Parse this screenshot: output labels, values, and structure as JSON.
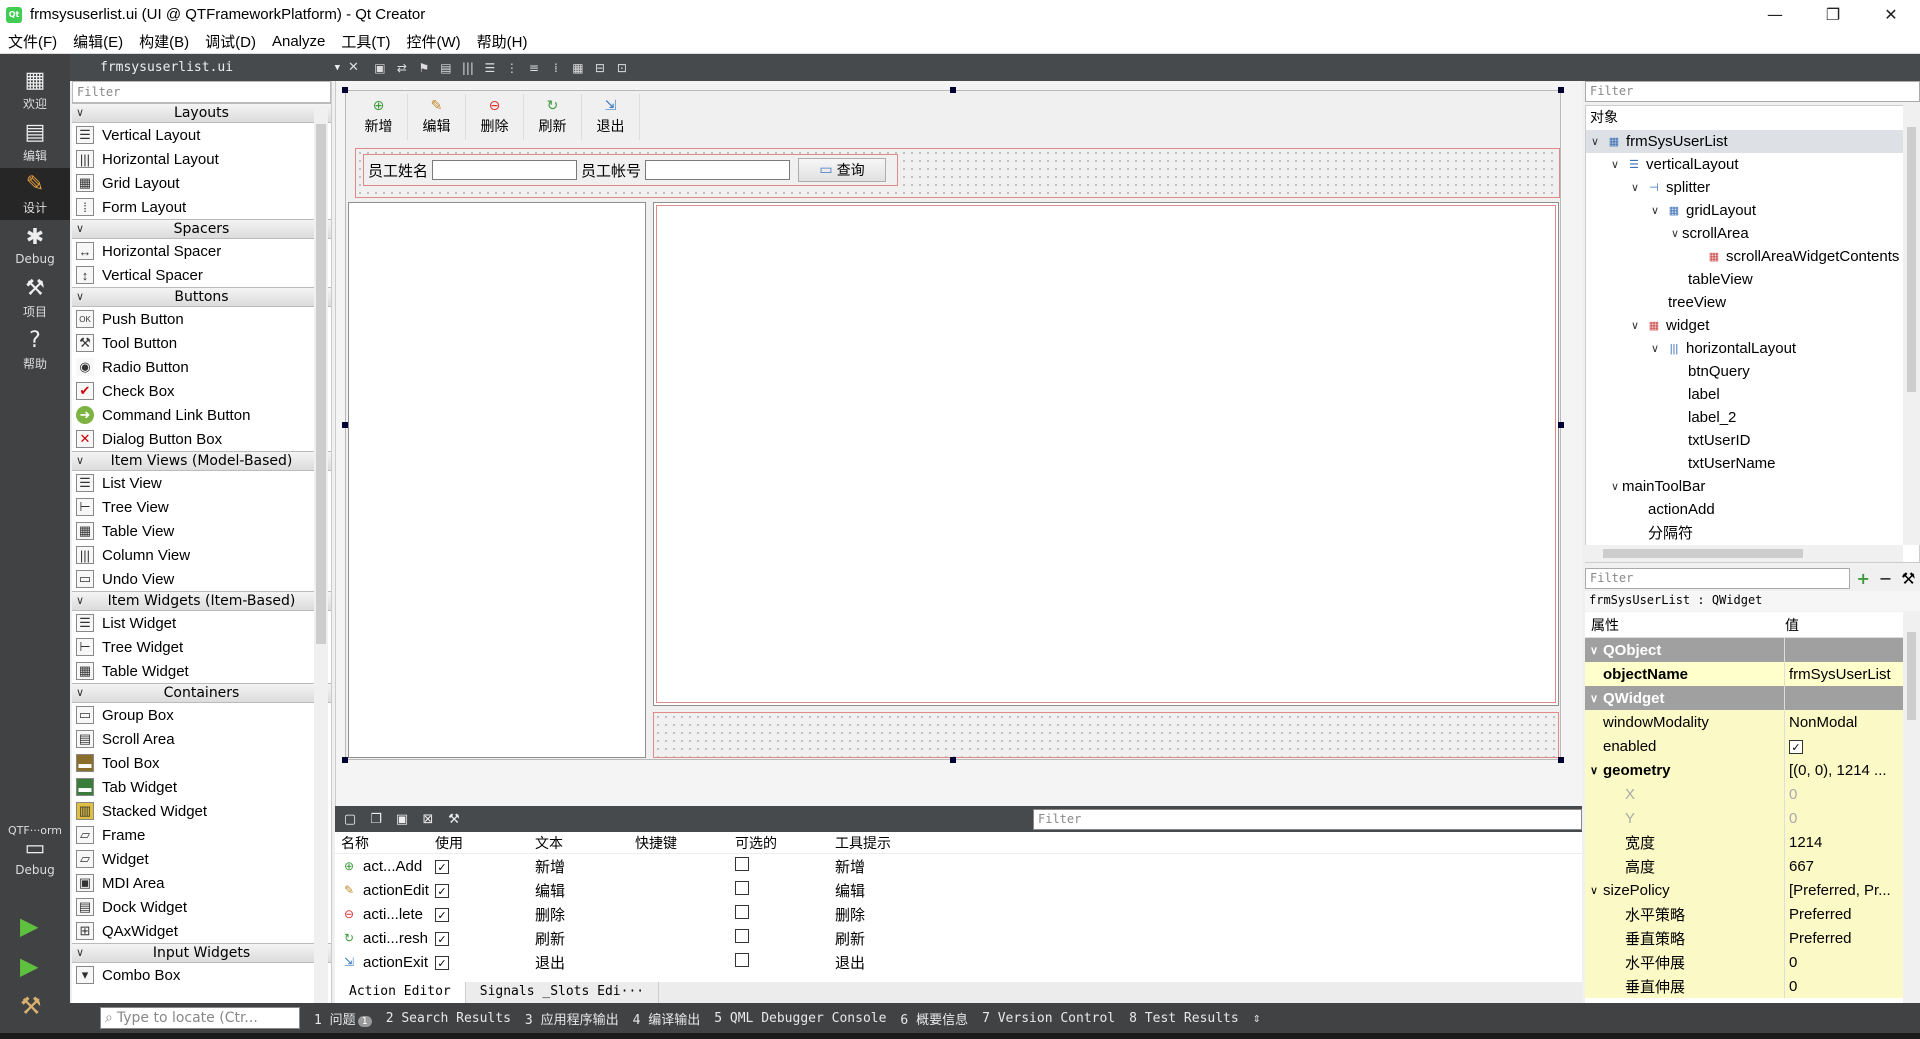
{
  "window": {
    "title": "frmsysuserlist.ui (UI @ QTFrameworkPlatform) - Qt Creator",
    "minimize": "—",
    "restore": "❐",
    "close": "✕"
  },
  "menu": [
    "文件(F)",
    "编辑(E)",
    "构建(B)",
    "调试(D)",
    "Analyze",
    "工具(T)",
    "控件(W)",
    "帮助(H)"
  ],
  "modes": {
    "welcome": "欢迎",
    "edit": "编辑",
    "design": "设计",
    "debug": "Debug",
    "projects": "项目",
    "help": "帮助",
    "kit_label": "QTF···orm",
    "kit_mode": "Debug"
  },
  "editor": {
    "file": "frmsysuserlist.ui",
    "close": "✕"
  },
  "widgetbox": {
    "filter_placeholder": "Filter",
    "categories": {
      "layouts": "Layouts",
      "spacers": "Spacers",
      "buttons": "Buttons",
      "item_views": "Item Views (Model-Based)",
      "item_widgets": "Item Widgets (Item-Based)",
      "containers": "Containers",
      "input_widgets": "Input Widgets"
    },
    "layouts": [
      "Vertical Layout",
      "Horizontal Layout",
      "Grid Layout",
      "Form Layout"
    ],
    "spacers": [
      "Horizontal Spacer",
      "Vertical Spacer"
    ],
    "buttons": [
      "Push Button",
      "Tool Button",
      "Radio Button",
      "Check Box",
      "Command Link Button",
      "Dialog Button Box"
    ],
    "item_views": [
      "List View",
      "Tree View",
      "Table View",
      "Column View",
      "Undo View"
    ],
    "item_widgets": [
      "List Widget",
      "Tree Widget",
      "Table Widget"
    ],
    "containers": [
      "Group Box",
      "Scroll Area",
      "Tool Box",
      "Tab Widget",
      "Stacked Widget",
      "Frame",
      "Widget",
      "MDI Area",
      "Dock Widget",
      "QAxWidget"
    ],
    "input_widgets": [
      "Combo Box"
    ]
  },
  "form": {
    "toolbar": [
      "新增",
      "编辑",
      "删除",
      "刷新",
      "退出"
    ],
    "label_name": "员工姓名",
    "label_account": "员工帐号",
    "query_button": "查询"
  },
  "action_editor": {
    "filter_placeholder": "Filter",
    "headers": [
      "名称",
      "使用",
      "文本",
      "快捷键",
      "可选的",
      "工具提示"
    ],
    "rows": [
      {
        "name": "act...Add",
        "used": "✓",
        "text": "新增",
        "tooltip": "新增"
      },
      {
        "name": "actionEdit",
        "used": "✓",
        "text": "编辑",
        "tooltip": "编辑"
      },
      {
        "name": "acti...lete",
        "used": "✓",
        "text": "删除",
        "tooltip": "删除"
      },
      {
        "name": "acti...resh",
        "used": "✓",
        "text": "刷新",
        "tooltip": "刷新"
      },
      {
        "name": "actionExit",
        "used": "✓",
        "text": "退出",
        "tooltip": "退出"
      }
    ],
    "tabs": [
      "Action Editor",
      "Signals _Slots Edi···"
    ]
  },
  "object_inspector": {
    "filter_placeholder": "Filter",
    "header": "对象",
    "items": [
      {
        "label": "frmSysUserList",
        "chev": "∨"
      },
      {
        "label": "verticalLayout",
        "chev": "∨"
      },
      {
        "label": "splitter",
        "chev": "∨"
      },
      {
        "label": "gridLayout",
        "chev": "∨"
      },
      {
        "label": "scrollArea",
        "chev": "∨"
      },
      {
        "label": "scrollAreaWidgetContents",
        "chev": ""
      },
      {
        "label": "tableView",
        "chev": ""
      },
      {
        "label": "treeView",
        "chev": ""
      },
      {
        "label": "widget",
        "chev": "∨"
      },
      {
        "label": "horizontalLayout",
        "chev": "∨"
      },
      {
        "label": "btnQuery",
        "chev": ""
      },
      {
        "label": "label",
        "chev": ""
      },
      {
        "label": "label_2",
        "chev": ""
      },
      {
        "label": "txtUserID",
        "chev": ""
      },
      {
        "label": "txtUserName",
        "chev": ""
      },
      {
        "label": "mainToolBar",
        "chev": "∨"
      },
      {
        "label": "actionAdd",
        "chev": ""
      },
      {
        "label": "分隔符",
        "chev": ""
      }
    ]
  },
  "property_editor": {
    "filter_placeholder": "Filter",
    "class_label": "frmSysUserList : QWidget",
    "header_property": "属性",
    "header_value": "值",
    "rows": [
      {
        "name": "QObject",
        "value": "",
        "chev": "∨"
      },
      {
        "name": "objectName",
        "value": "frmSysUserList",
        "chev": ""
      },
      {
        "name": "QWidget",
        "value": "",
        "chev": "∨"
      },
      {
        "name": "windowModality",
        "value": "NonModal",
        "chev": ""
      },
      {
        "name": "enabled",
        "value": "✓",
        "chev": ""
      },
      {
        "name": "geometry",
        "value": "[(0, 0), 1214 ...",
        "chev": "∨"
      },
      {
        "name": "X",
        "value": "0",
        "chev": ""
      },
      {
        "name": "Y",
        "value": "0",
        "chev": ""
      },
      {
        "name": "宽度",
        "value": "1214",
        "chev": ""
      },
      {
        "name": "高度",
        "value": "667",
        "chev": ""
      },
      {
        "name": "sizePolicy",
        "value": "[Preferred, Pr...",
        "chev": "∨"
      },
      {
        "name": "水平策略",
        "value": "Preferred",
        "chev": ""
      },
      {
        "name": "垂直策略",
        "value": "Preferred",
        "chev": ""
      },
      {
        "name": "水平伸展",
        "value": "0",
        "chev": ""
      },
      {
        "name": "垂直伸展",
        "value": "0",
        "chev": ""
      }
    ]
  },
  "statusbar": {
    "locator_placeholder": "Type to locate (Ctr...",
    "items": [
      "1 问题",
      "2 Search Results",
      "3 应用程序输出",
      "4 编译输出",
      "5 QML Debugger Console",
      "6 概要信息",
      "7 Version Control",
      "8 Test Results"
    ],
    "issues_badge": "1",
    "more": "⇕"
  }
}
